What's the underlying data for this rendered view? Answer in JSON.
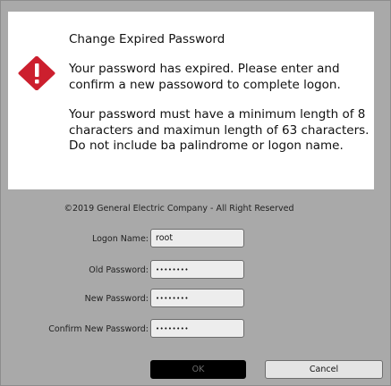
{
  "message": {
    "title": "Change Expired Password",
    "paragraph1": "Your password has expired. Please enter and confirm a new passoword to complete logon.",
    "paragraph2": "Your password must have a minimum length of 8 characters and maximun length of 63 characters. Do not include ba palindrome or logon name.",
    "icon": "alert-icon",
    "icon_color": "#cc1f2e"
  },
  "footer": {
    "copyright": "©2019 General Electric Company - All Right Reserved"
  },
  "form": {
    "logon_name_label": "Logon Name:",
    "logon_name_value": "root",
    "old_password_label": "Old Password:",
    "old_password_value": "••••••••",
    "new_password_label": "New Password:",
    "new_password_value": "••••••••",
    "confirm_password_label": "Confirm New Password:",
    "confirm_password_value": "••••••••"
  },
  "buttons": {
    "ok_label": "OK",
    "cancel_label": "Cancel"
  },
  "colors": {
    "background": "#a9a9a9",
    "panel": "#ffffff",
    "ok_button": "#000000"
  }
}
